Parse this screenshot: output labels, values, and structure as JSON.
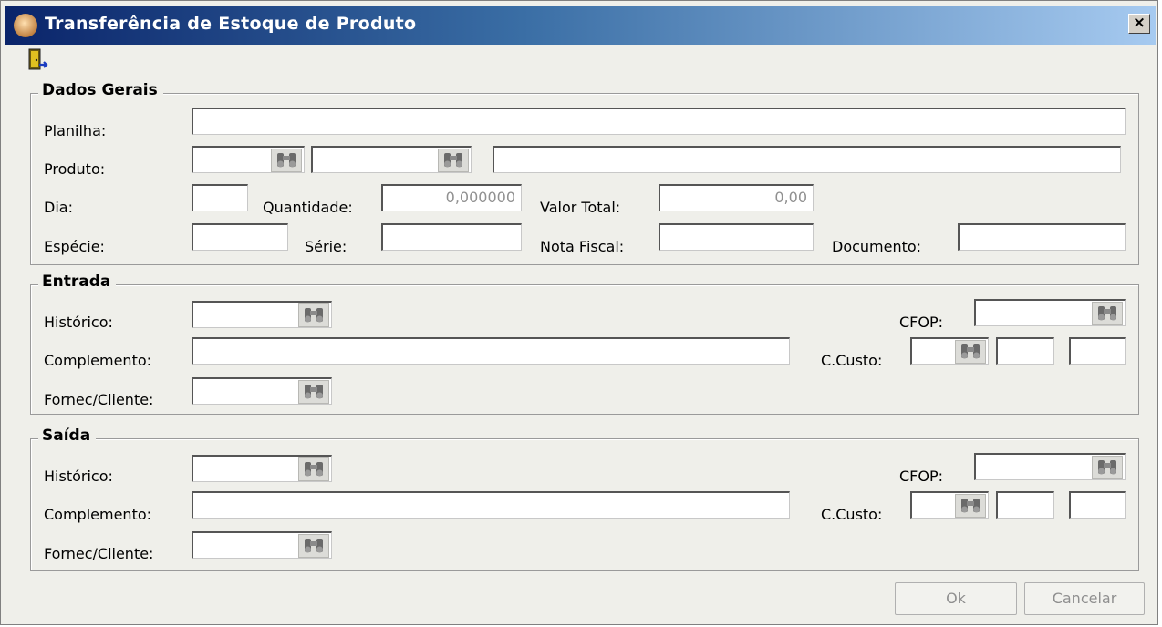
{
  "window": {
    "title": "Transferência de Estoque de Produto",
    "close_label": "×"
  },
  "dados_gerais": {
    "title": "Dados Gerais",
    "planilha_label": "Planilha:",
    "produto_label": "Produto:",
    "dia_label": "Dia:",
    "quantidade_label": "Quantidade:",
    "quantidade_value": "0,000000",
    "valor_total_label": "Valor Total:",
    "valor_total_value": "0,00",
    "especie_label": "Espécie:",
    "serie_label": "Série:",
    "nota_fiscal_label": "Nota Fiscal:",
    "documento_label": "Documento:"
  },
  "entrada": {
    "title": "Entrada",
    "historico_label": "Histórico:",
    "complemento_label": "Complemento:",
    "fornec_label": "Fornec/Cliente:",
    "cfop_label": "CFOP:",
    "ccusto_label": "C.Custo:"
  },
  "saida": {
    "title": "Saída",
    "historico_label": "Histórico:",
    "complemento_label": "Complemento:",
    "fornec_label": "Fornec/Cliente:",
    "cfop_label": "CFOP:",
    "ccusto_label": "C.Custo:"
  },
  "buttons": {
    "ok": "Ok",
    "cancelar": "Cancelar"
  },
  "icons": {
    "title": "person-icon",
    "exit": "exit-door-icon",
    "search": "binoculars-icon"
  }
}
